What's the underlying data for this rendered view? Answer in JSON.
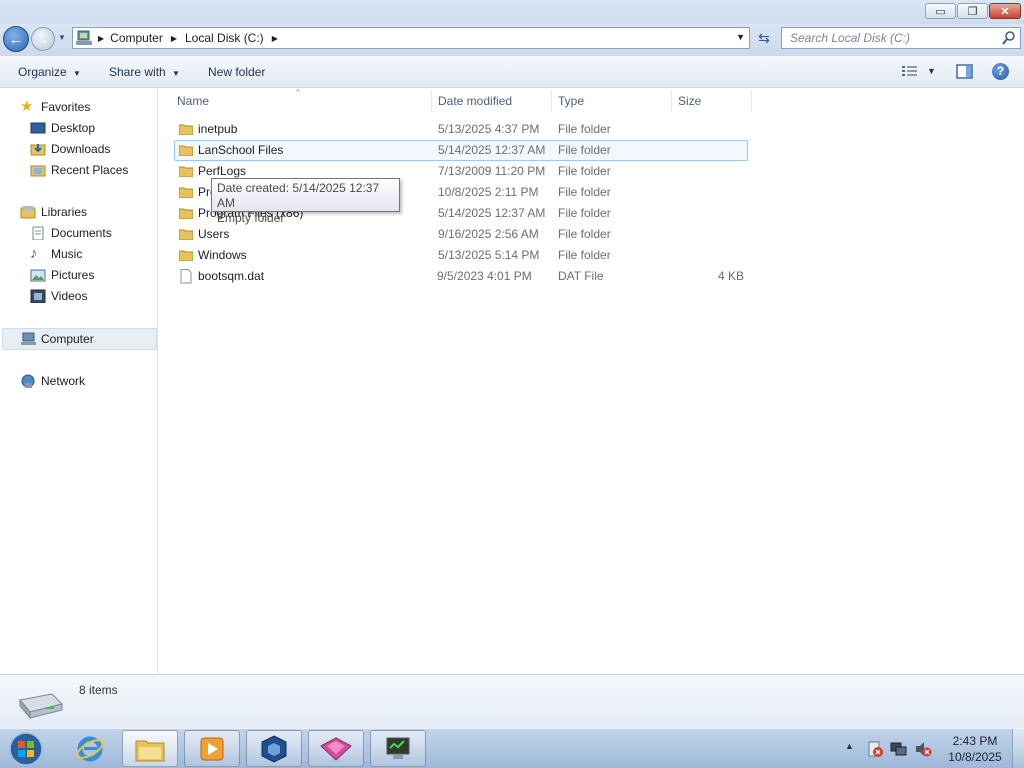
{
  "window": {
    "minimize_glyph": "▭",
    "restore_glyph": "❐",
    "close_glyph": "✕"
  },
  "address": {
    "crumbs": [
      "Computer",
      "Local Disk (C:)"
    ],
    "search_placeholder": "Search Local Disk (C:)"
  },
  "toolbar": {
    "organize": "Organize",
    "share_with": "Share with",
    "new_folder": "New folder"
  },
  "nav": {
    "favorites": "Favorites",
    "desktop": "Desktop",
    "downloads": "Downloads",
    "recent_places": "Recent Places",
    "libraries": "Libraries",
    "documents": "Documents",
    "music": "Music",
    "pictures": "Pictures",
    "videos": "Videos",
    "computer": "Computer",
    "network": "Network"
  },
  "columns": {
    "name": "Name",
    "date_modified": "Date modified",
    "type": "Type",
    "size": "Size"
  },
  "files": [
    {
      "name": "inetpub",
      "date": "5/13/2025 4:37 PM",
      "type": "File folder",
      "size": "",
      "kind": "folder"
    },
    {
      "name": "LanSchool Files",
      "date": "5/14/2025 12:37 AM",
      "type": "File folder",
      "size": "",
      "kind": "folder",
      "selected": true
    },
    {
      "name": "PerfLogs",
      "date": "7/13/2009 11:20 PM",
      "type": "File folder",
      "size": "",
      "kind": "folder"
    },
    {
      "name": "Program Files",
      "date": "10/8/2025 2:11 PM",
      "type": "File folder",
      "size": "",
      "kind": "folder"
    },
    {
      "name": "Program Files (x86)",
      "date": "5/14/2025 12:37 AM",
      "type": "File folder",
      "size": "",
      "kind": "folder"
    },
    {
      "name": "Users",
      "date": "9/16/2025 2:56 AM",
      "type": "File folder",
      "size": "",
      "kind": "folder"
    },
    {
      "name": "Windows",
      "date": "5/13/2025 5:14 PM",
      "type": "File folder",
      "size": "",
      "kind": "folder"
    },
    {
      "name": "bootsqm.dat",
      "date": "9/5/2023 4:01 PM",
      "type": "DAT File",
      "size": "4 KB",
      "kind": "file"
    }
  ],
  "tooltip": {
    "line1": "Date created: 5/14/2025 12:37 AM",
    "line2": "Empty folder"
  },
  "status": {
    "item_count": "8 items"
  },
  "taskbar": {
    "apps": [
      "internet-explorer",
      "windows-explorer",
      "media-player",
      "virtualbox",
      "app-pink",
      "remote-monitor"
    ],
    "time": "2:43 PM",
    "date": "10/8/2025"
  },
  "colors": {
    "accent": "#2a66b7",
    "selection_border": "#99c9f5",
    "folder": "#e8c25a"
  }
}
